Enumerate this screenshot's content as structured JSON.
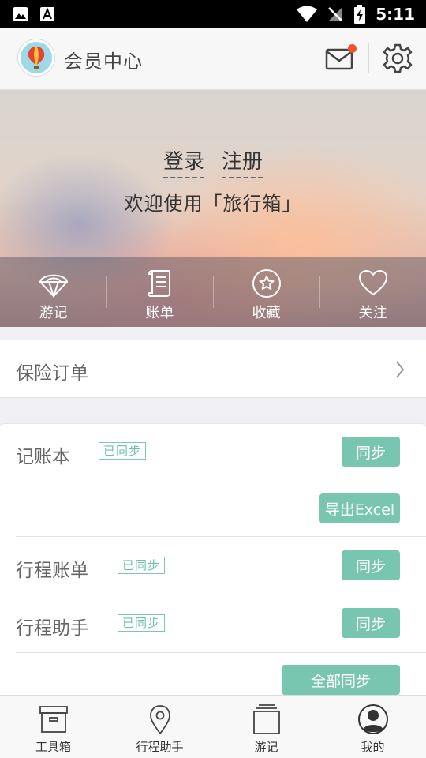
{
  "status_bar": {
    "time": "5:11",
    "icons": [
      "image-icon",
      "font-a-icon",
      "wifi-icon",
      "no-signal-icon",
      "battery-charging-icon"
    ]
  },
  "header": {
    "title": "会员中心",
    "icons": [
      "balloon-logo-icon",
      "mail-icon",
      "gear-icon"
    ],
    "accent_color": "#f0542d"
  },
  "banner": {
    "login_label": "登录",
    "register_label": "注册",
    "welcome_text": "欢迎使用「旅行箱」",
    "quick_items": [
      {
        "label": "游记",
        "icon": "parachute-icon"
      },
      {
        "label": "账单",
        "icon": "scroll-icon"
      },
      {
        "label": "收藏",
        "icon": "star-icon"
      },
      {
        "label": "关注",
        "icon": "heart-icon"
      }
    ]
  },
  "insurance": {
    "label": "保险订单",
    "icon": "chevron-right-icon"
  },
  "sync_section": {
    "button_color": "#79c6b0",
    "rows": [
      {
        "title": "记账本",
        "badge": "已同步",
        "sync_label": "同步",
        "export_label": "导出Excel"
      },
      {
        "title": "行程账单",
        "badge": "已同步",
        "sync_label": "同步"
      },
      {
        "title": "行程助手",
        "badge": "已同步",
        "sync_label": "同步"
      }
    ],
    "sync_all_label": "全部同步"
  },
  "bottom_nav": {
    "items": [
      {
        "label": "工具箱",
        "icon": "toolbox-icon"
      },
      {
        "label": "行程助手",
        "icon": "location-pin-icon"
      },
      {
        "label": "游记",
        "icon": "stack-icon"
      },
      {
        "label": "我的",
        "icon": "user-icon",
        "active": true
      }
    ]
  }
}
